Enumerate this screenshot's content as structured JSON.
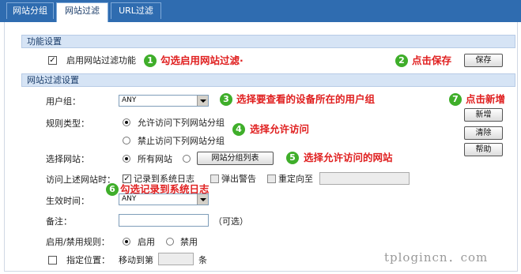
{
  "tabs": [
    {
      "label": "网站分组"
    },
    {
      "label": "网站过滤"
    },
    {
      "label": "URL过滤"
    }
  ],
  "function_section": {
    "title": "功能设置",
    "enable_label": "启用网站过滤功能",
    "enable_checked": true,
    "save_label": "保存"
  },
  "filter_section": {
    "title": "网站过滤设置",
    "user_group_label": "用户组：",
    "user_group_value": "ANY",
    "rule_type_label": "规则类型：",
    "rule_allow_label": "允许访问下列网站分组",
    "rule_deny_label": "禁止访问下列网站分组",
    "select_site_label": "选择网站：",
    "all_sites_label": "所有网站",
    "site_group_list_label": "网站分组列表",
    "on_access_label": "访问上述网站时：",
    "log_label": "记录到系统日志",
    "popup_label": "弹出警告",
    "redirect_label": "重定向至",
    "effective_time_label": "生效时间：",
    "effective_time_value": "ANY",
    "remark_label": "备注：",
    "optional_label": "（可选）",
    "enable_rule_label": "启用/禁用规则：",
    "enable_label": "启用",
    "disable_label": "禁用",
    "position_label": "指定位置：",
    "move_to_label": "移动到第",
    "item_unit": "条"
  },
  "side_buttons": {
    "add": "新增",
    "clear": "清除",
    "help": "帮助"
  },
  "annotations": [
    {
      "num": "1",
      "text": "勾选启用网站过滤·"
    },
    {
      "num": "2",
      "text": "点击保存"
    },
    {
      "num": "3",
      "text": "选择要查看的设备所在的用户组"
    },
    {
      "num": "4",
      "text": "选择允许访问"
    },
    {
      "num": "5",
      "text": "选择允许访问的网站"
    },
    {
      "num": "6",
      "text": "勾选记录到系统日志"
    },
    {
      "num": "7",
      "text": "点击新增"
    }
  ],
  "colors": {
    "tabbar": "#2f6cb0",
    "section_bg": "#d6e4f5",
    "badge": "#3fae2a",
    "annotation": "#e02020"
  },
  "watermark": "tplogincn．com"
}
